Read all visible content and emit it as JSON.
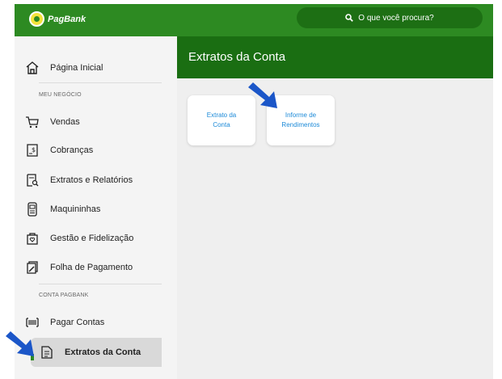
{
  "brand": {
    "name": "PagBank"
  },
  "search": {
    "placeholder": "O que você procura?"
  },
  "sidebar": {
    "home": "Página Inicial",
    "section1": "MEU NEGÓCIO",
    "items1": [
      "Vendas",
      "Cobranças",
      "Extratos e Relatórios",
      "Maquininhas",
      "Gestão e Fidelização",
      "Folha de Pagamento"
    ],
    "section2": "CONTA PAGBANK",
    "items2": [
      "Pagar Contas",
      "Extratos da Conta"
    ]
  },
  "main": {
    "title": "Extratos da Conta",
    "cards": [
      {
        "line1": "Extrato da",
        "line2": "Conta"
      },
      {
        "line1": "Informe de",
        "line2": "Rendimentos"
      }
    ]
  },
  "colors": {
    "green": "#2d8a22",
    "dark_green": "#1a6e12",
    "link_blue": "#1c8ad8",
    "arrow_blue": "#1b56c8"
  }
}
